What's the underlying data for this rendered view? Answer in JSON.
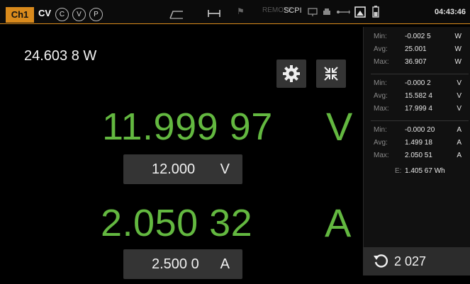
{
  "topbar": {
    "channel": "Ch1",
    "mode": "CV",
    "protections": [
      "C",
      "V",
      "P"
    ],
    "remote": "REMOTE",
    "scpi": "SCPI",
    "time": "04:43:46"
  },
  "main": {
    "power": "24.603 8 W",
    "voltage": {
      "value": "11.999 97",
      "unit": "V",
      "set_value": "12.000",
      "set_unit": "V"
    },
    "current": {
      "value": "2.050 32",
      "unit": "A",
      "set_value": "2.500 0",
      "set_unit": "A"
    }
  },
  "stats": {
    "power": [
      {
        "label": "Min:",
        "value": "-0.002 5",
        "unit": "W"
      },
      {
        "label": "Avg:",
        "value": "25.001",
        "unit": "W"
      },
      {
        "label": "Max:",
        "value": "36.907",
        "unit": "W"
      }
    ],
    "voltage": [
      {
        "label": "Min:",
        "value": "-0.000 2",
        "unit": "V"
      },
      {
        "label": "Avg:",
        "value": "15.582 4",
        "unit": "V"
      },
      {
        "label": "Max:",
        "value": "17.999 4",
        "unit": "V"
      }
    ],
    "current": [
      {
        "label": "Min:",
        "value": "-0.000 20",
        "unit": "A"
      },
      {
        "label": "Avg:",
        "value": "1.499 18",
        "unit": "A"
      },
      {
        "label": "Max:",
        "value": "2.050 51",
        "unit": "A"
      }
    ],
    "energy": {
      "label": "E:",
      "value": "1.405 67 Wh"
    }
  },
  "counter": {
    "value": "2 027"
  },
  "colors": {
    "accent": "#d98a1c",
    "reading": "#63b840",
    "panel": "#343434"
  }
}
